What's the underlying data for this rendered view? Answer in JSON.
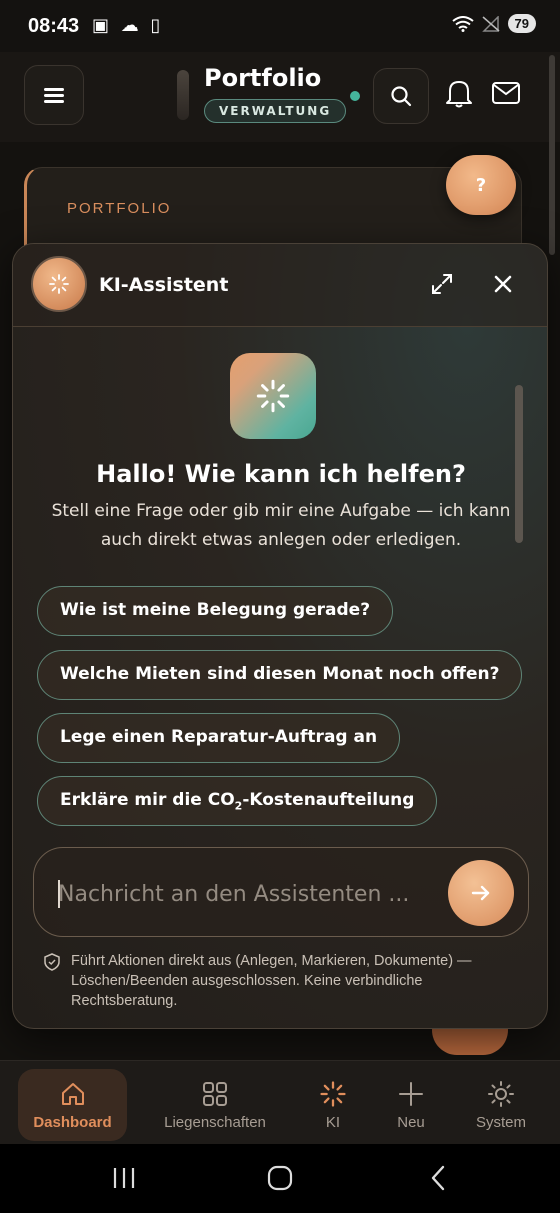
{
  "status_bar": {
    "time": "08:43",
    "icons_left": "▣ ☁ ▯",
    "battery": "79"
  },
  "header": {
    "title": "Portfolio",
    "subtitle": "VERWALTUNG"
  },
  "background": {
    "portfolio_label": "PORTFOLIO",
    "help_button": "?"
  },
  "assistant": {
    "title": "KI-Assistent",
    "greeting": "Hallo! Wie kann ich helfen?",
    "subtitle": "Stell eine Frage oder gib mir eine Aufgabe — ich kann auch direkt etwas anlegen oder erledigen.",
    "suggestions": [
      "Wie ist meine Belegung gerade?",
      "Welche Mieten sind diesen Monat noch offen?",
      "Lege einen Reparatur-Auftrag an"
    ],
    "suggestion_co2_prefix": "Erkläre mir die CO",
    "suggestion_co2_sub": "2",
    "suggestion_co2_suffix": "-Kostenaufteilung",
    "input_placeholder": "Nachricht an den Assistenten ...",
    "input_value": "",
    "disclaimer": "Führt Aktionen direkt aus (Anlegen, Markieren, Dokumente) — Löschen/Beenden ausgeschlossen. Keine verbindliche Rechtsberatung."
  },
  "nav": {
    "items": [
      {
        "label": "Dashboard",
        "icon": "home-icon",
        "active": true
      },
      {
        "label": "Liegenschaften",
        "icon": "grid-icon"
      },
      {
        "label": "KI",
        "icon": "sparkle-icon"
      },
      {
        "label": "Neu",
        "icon": "plus-icon"
      },
      {
        "label": "System",
        "icon": "gear-icon"
      }
    ]
  },
  "colors": {
    "accent": "#d98e5e",
    "teal": "#45b59c",
    "background": "#1d1a17"
  }
}
